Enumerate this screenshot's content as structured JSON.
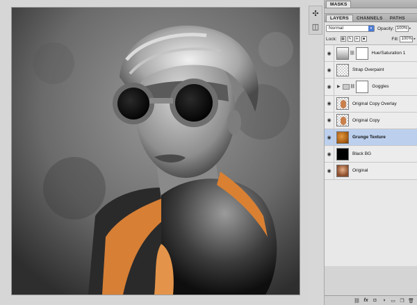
{
  "panels": {
    "masks_tab": "MASKS",
    "tabs": [
      {
        "label": "LAYERS",
        "active": true
      },
      {
        "label": "CHANNELS",
        "active": false
      },
      {
        "label": "PATHS",
        "active": false
      }
    ],
    "blend_mode": "Normal",
    "opacity_label": "Opacity:",
    "opacity_value": "100%",
    "lock_label": "Lock:",
    "fill_label": "Fill:",
    "fill_value": "100%"
  },
  "layers": [
    {
      "name": "Hue/Saturation 1",
      "type": "adjustment",
      "visible": true,
      "selected": false
    },
    {
      "name": "Strap Overpaint",
      "type": "transparent",
      "visible": true,
      "selected": false
    },
    {
      "name": "Goggles",
      "type": "group",
      "visible": true,
      "selected": false
    },
    {
      "name": "Original Copy Overlay",
      "type": "photo-transparent",
      "visible": true,
      "selected": false
    },
    {
      "name": "Original Copy",
      "type": "photo-transparent",
      "visible": true,
      "selected": false
    },
    {
      "name": "Grunge Texture",
      "type": "texture",
      "visible": true,
      "selected": true
    },
    {
      "name": "Black BG",
      "type": "black",
      "visible": true,
      "selected": false
    },
    {
      "name": "Original",
      "type": "photo",
      "visible": true,
      "selected": false
    }
  ],
  "footer_icons": [
    "link-icon",
    "fx-icon",
    "mask-icon",
    "adjustment-icon",
    "folder-icon",
    "new-layer-icon",
    "trash-icon"
  ],
  "colors": {
    "selection": "#bcd0ee",
    "accent_orange": "#e08a3c",
    "select_arrow": "#4c7bd6"
  }
}
